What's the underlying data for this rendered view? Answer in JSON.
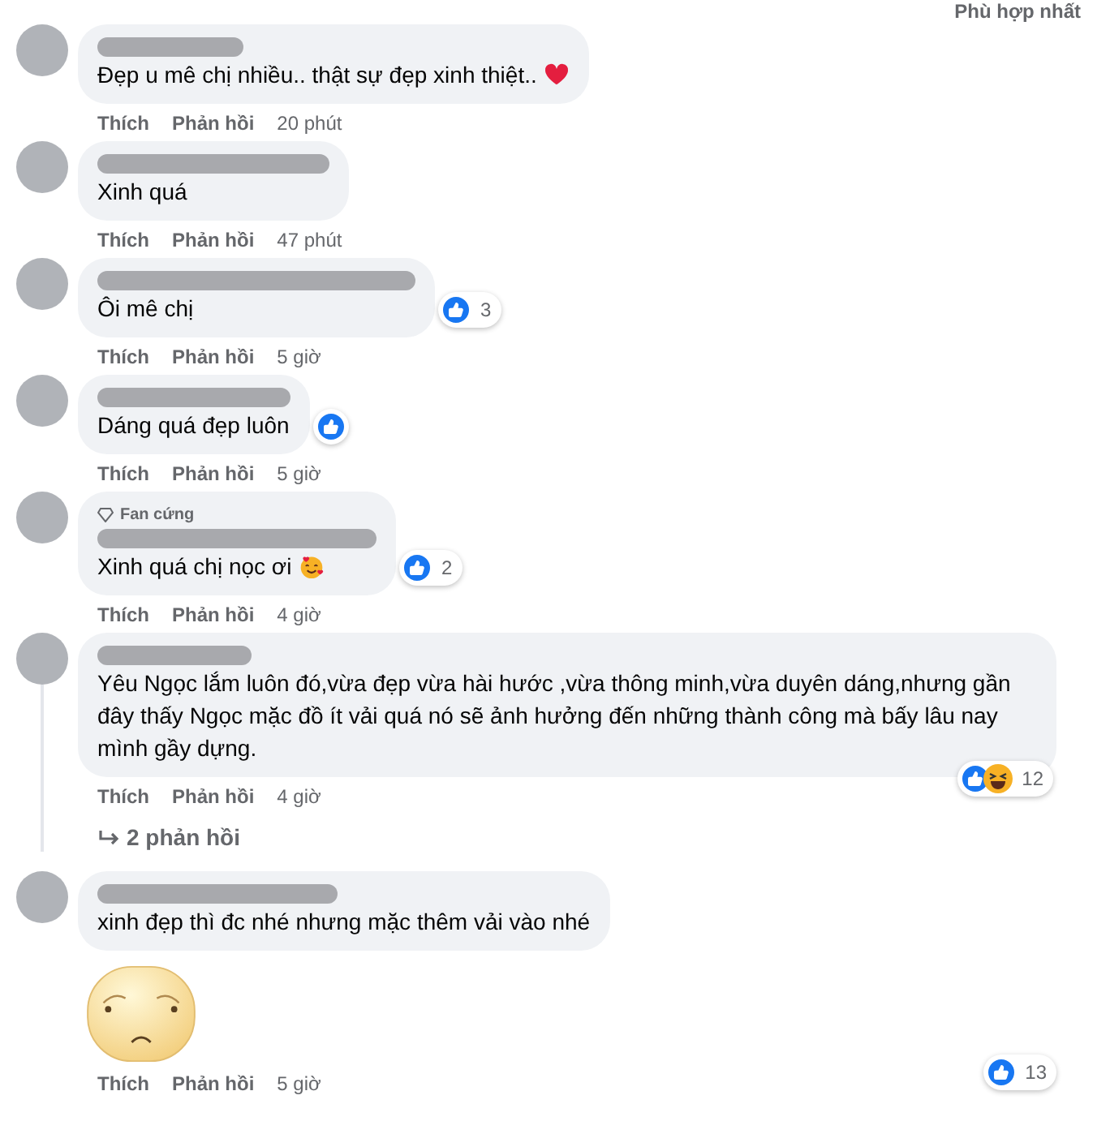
{
  "sort": {
    "label": "Phù hợp nhất"
  },
  "comments": [
    {
      "text": "Đẹp u mê chị nhiều.. thật sự đẹp xinh thiệt..",
      "emoji": {
        "kind": "heart"
      },
      "actions": [
        "Thích",
        "Phản hồi"
      ],
      "time": "20 phút"
    },
    {
      "text": "Xinh quá",
      "actions": [
        "Thích",
        "Phản hồi"
      ],
      "time": "47 phút"
    },
    {
      "text": "Ôi mê chị",
      "reaction": {
        "kind": "inline",
        "icons": [
          {
            "kind": "like"
          }
        ],
        "count": "3"
      },
      "actions": [
        "Thích",
        "Phản hồi"
      ],
      "time": "5 giờ"
    },
    {
      "text": "Dáng quá đẹp luôn",
      "reaction": {
        "kind": "inline",
        "icons": [
          {
            "kind": "like"
          }
        ]
      },
      "actions": [
        "Thích",
        "Phản hồi"
      ],
      "time": "5 giờ"
    },
    {
      "badge": "Fan cứng",
      "text": "Xinh quá chị nọc ơi",
      "emoji": {
        "kind": "smiling-hearts"
      },
      "reaction": {
        "kind": "inline",
        "icons": [
          {
            "kind": "like"
          }
        ],
        "count": "2"
      },
      "actions": [
        "Thích",
        "Phản hồi"
      ],
      "time": "4 giờ"
    },
    {
      "text": "Yêu Ngọc lắm luôn đó,vừa đẹp vừa hài hước ,vừa thông minh,vừa duyên dáng,nhưng gần đây thấy Ngọc mặc đồ ít vải quá nó sẽ ảnh hưởng đến những thành công mà bấy lâu nay mình gầy dựng.",
      "reaction": {
        "kind": "corner",
        "icons": [
          {
            "kind": "like"
          },
          {
            "kind": "haha"
          }
        ],
        "count": "12"
      },
      "actions": [
        "Thích",
        "Phản hồi"
      ],
      "time": "4 giờ",
      "replies": "2 phản hồi"
    },
    {
      "text": "xinh đẹp thì đc nhé nhưng mặc thêm vải vào nhé",
      "sticker": {
        "kind": "worried-face"
      },
      "reaction": {
        "kind": "below",
        "icons": [
          {
            "kind": "like"
          }
        ],
        "count": "13"
      },
      "actions": [
        "Thích",
        "Phản hồi"
      ],
      "time": "5 giờ"
    }
  ]
}
